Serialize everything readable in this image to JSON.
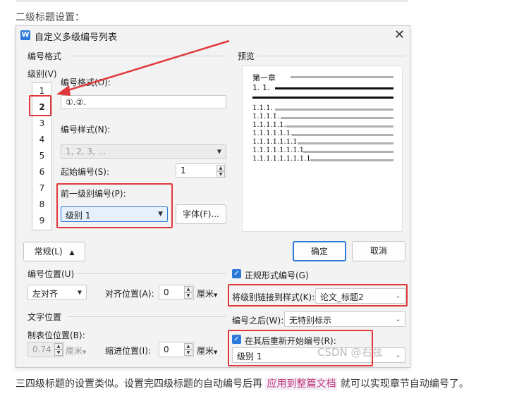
{
  "article": {
    "heading": "二级标题设置：",
    "footer_before": "三四级标题的设置类似。设置完四级标题的自动编号后再",
    "footer_link": "应用到整篇文档",
    "footer_after": "就可以实现章节自动编号了。",
    "watermark": "CSDN @右弦"
  },
  "dialog": {
    "app_icon": "W",
    "title": "自定义多级编号列表",
    "close_icon": "close-icon",
    "number_format_group": "编号格式",
    "level_label": "级别(V)",
    "levels": [
      "1",
      "2",
      "3",
      "4",
      "5",
      "6",
      "7",
      "8",
      "9"
    ],
    "selected_level": "2",
    "format_label": "编号格式(O):",
    "format_value": "①.②.",
    "style_label": "编号样式(N):",
    "style_value": "1, 2, 3, ...",
    "start_label": "起始编号(S):",
    "start_value": "1",
    "prev_level_label": "前一级别编号(P):",
    "prev_level_value": "级别 1",
    "font_button": "字体(F)...",
    "preview_group": "预览",
    "preview_lines": [
      "第一章",
      "1. 1.",
      "1.1.1.",
      "1.1.1.1.",
      "1.1.1.1.1.",
      "1.1.1.1.1.1.",
      "1.1.1.1.1.1.1.",
      "1.1.1.1.1.1.1.1.",
      "1.1.1.1.1.1.1.1.1."
    ],
    "general_button": "常规(L)",
    "ok_button": "确定",
    "cancel_button": "取消",
    "position_group": "编号位置(U)",
    "align_value": "左对齐",
    "align_pos_label": "对齐位置(A):",
    "align_pos_value": "0",
    "unit": "厘米",
    "text_pos_group": "文字位置",
    "tab_pos_label": "制表位位置(B):",
    "tab_pos_value": "0.74",
    "indent_label": "缩进位置(I):",
    "indent_value": "0",
    "legal_label": "正规形式编号(G)",
    "link_style_label": "将级别链接到样式(K):",
    "link_style_value": "论文_标题2",
    "after_label": "编号之后(W):",
    "after_value": "无特别标示",
    "restart_label": "在其后重新开始编号(R):",
    "restart_value": "级别 1"
  },
  "colors": {
    "accent": "#2b79d9",
    "highlight": "#e0383b"
  }
}
